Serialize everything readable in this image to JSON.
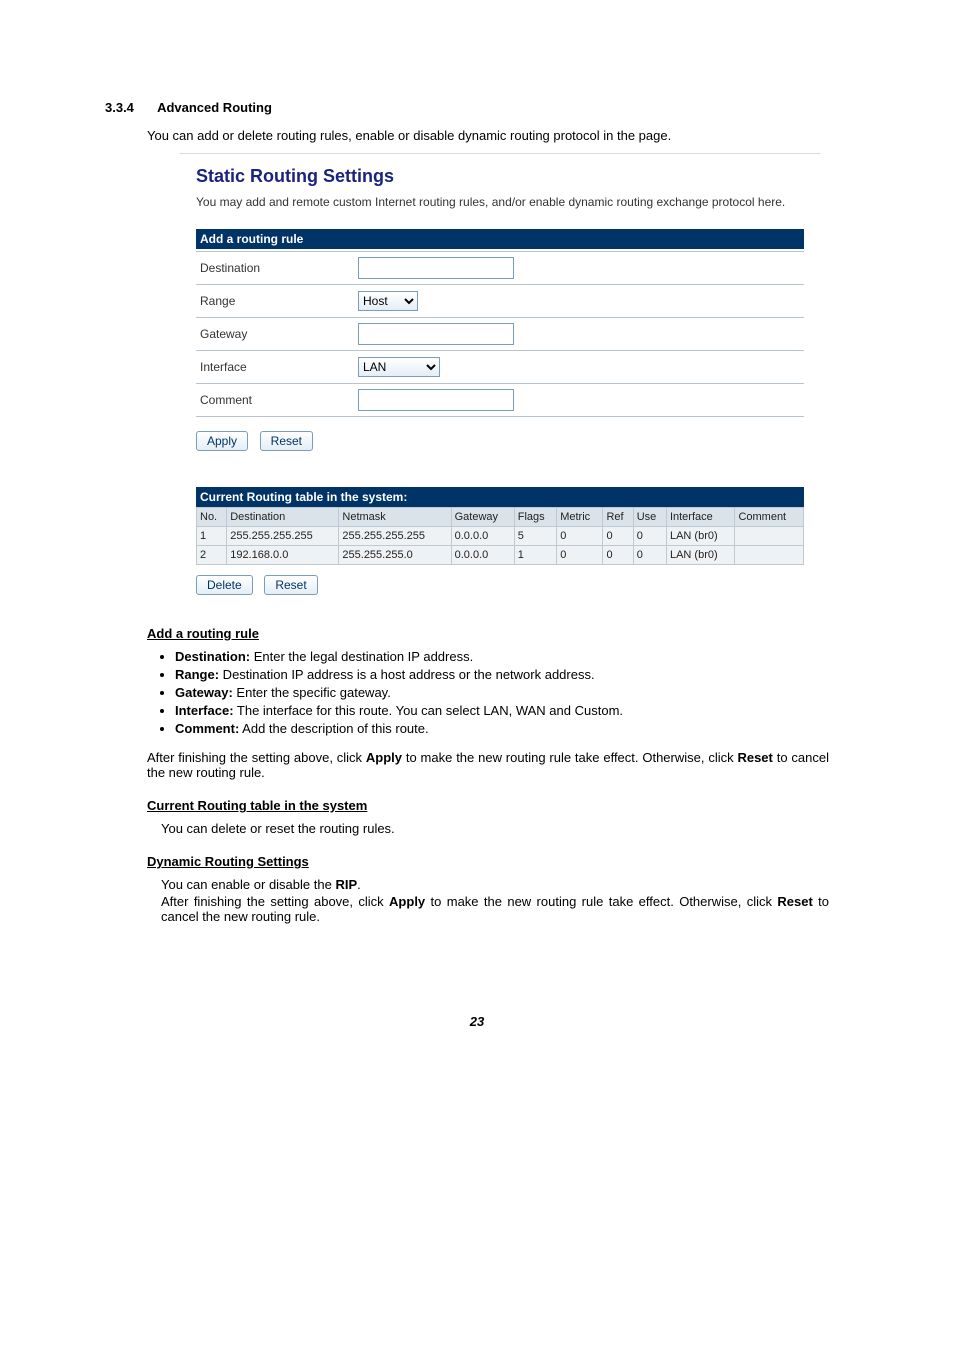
{
  "section": {
    "number": "3.3.4",
    "title": "Advanced Routing",
    "intro": "You can add or delete routing rules, enable or disable dynamic routing protocol in the page."
  },
  "panel": {
    "title": "Static Routing Settings",
    "description": "You may add and remote custom Internet routing rules, and/or enable dynamic routing exchange protocol here.",
    "add_rule_header": "Add a routing rule",
    "labels": {
      "destination": "Destination",
      "range": "Range",
      "gateway": "Gateway",
      "interface": "Interface",
      "comment": "Comment"
    },
    "range_selected": "Host",
    "interface_selected": "LAN",
    "buttons": {
      "apply": "Apply",
      "reset": "Reset",
      "delete": "Delete"
    },
    "current_table_header": "Current Routing table in the system:",
    "grid": {
      "headers": {
        "no": "No.",
        "destination": "Destination",
        "netmask": "Netmask",
        "gateway": "Gateway",
        "flags": "Flags",
        "metric": "Metric",
        "ref": "Ref",
        "use": "Use",
        "interface": "Interface",
        "comment": "Comment"
      },
      "rows": [
        {
          "no": "1",
          "destination": "255.255.255.255",
          "netmask": "255.255.255.255",
          "gateway": "0.0.0.0",
          "flags": "5",
          "metric": "0",
          "ref": "0",
          "use": "0",
          "interface": "LAN (br0)",
          "comment": ""
        },
        {
          "no": "2",
          "destination": "192.168.0.0",
          "netmask": "255.255.255.0",
          "gateway": "0.0.0.0",
          "flags": "1",
          "metric": "0",
          "ref": "0",
          "use": "0",
          "interface": "LAN (br0)",
          "comment": ""
        }
      ]
    }
  },
  "doc": {
    "sub1_title": "Add a routing rule",
    "bullets": [
      {
        "label": "Destination:",
        "text": " Enter the legal destination IP address."
      },
      {
        "label": "Range:",
        "text": " Destination IP address is a host address or the network address."
      },
      {
        "label": "Gateway:",
        "text": " Enter the specific gateway."
      },
      {
        "label": "Interface:",
        "text": " The interface for this route. You can select LAN, WAN and Custom."
      },
      {
        "label": "Comment:",
        "text": " Add the description of this route."
      }
    ],
    "para1a": "After finishing the setting above, click ",
    "para1b": "Apply",
    "para1c": " to make the new routing rule take effect. Otherwise, click ",
    "para1d": "Reset",
    "para1e": " to cancel the new routing rule.",
    "sub2_title": "Current Routing table in the system",
    "para2": "You can delete or reset the routing rules.",
    "sub3_title": "Dynamic Routing Settings",
    "para3a": "You can enable or disable the ",
    "para3b": "RIP",
    "para3c": ".",
    "para4a": "After finishing the setting above, click ",
    "para4b": "Apply",
    "para4c": " to make the new routing rule take effect. Otherwise, click ",
    "para4d": "Reset",
    "para4e": " to cancel the new routing rule.",
    "pagenum": "23"
  }
}
